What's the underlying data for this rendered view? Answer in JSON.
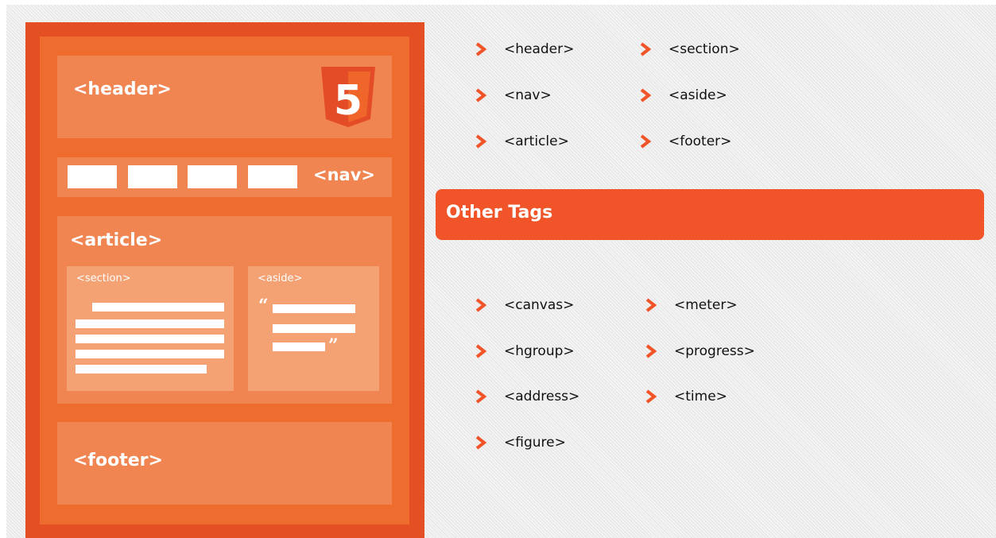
{
  "diagram": {
    "header_label": "<header>",
    "nav_label": "<nav>",
    "article_label": "<article>",
    "section_label": "<section>",
    "aside_label": "<aside>",
    "footer_label": "<footer>",
    "quote_open": "“",
    "quote_close": "”",
    "logo_icon": "html5-shield-icon",
    "logo_numeral": "5"
  },
  "semantic_tags": {
    "col1": [
      "<header>",
      "<nav>",
      "<article>"
    ],
    "col2": [
      "<section>",
      "<aside>",
      "<footer>"
    ]
  },
  "other_tags": {
    "title": "Other Tags",
    "col1": [
      "<canvas>",
      "<hgroup>",
      "<address>",
      "<figure>"
    ],
    "col2": [
      "<meter>",
      "<progress>",
      "<time>"
    ]
  },
  "colors": {
    "accent": "#f05428",
    "frame_outer": "#e54f24",
    "frame_inner": "#ef6c2f",
    "block": "#f08551",
    "sub_block": "#f4a173"
  }
}
